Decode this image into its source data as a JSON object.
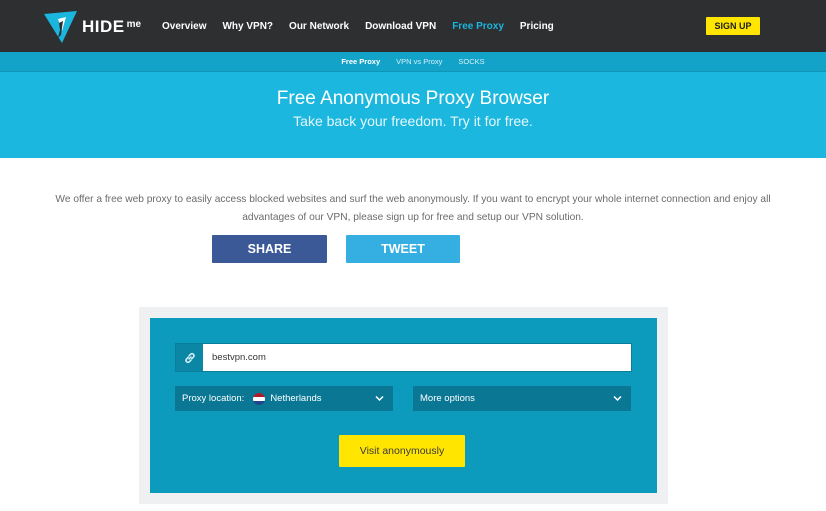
{
  "header": {
    "logo_text": "HIDE",
    "logo_suffix": "me",
    "nav": [
      {
        "label": "Overview",
        "active": false
      },
      {
        "label": "Why VPN?",
        "active": false
      },
      {
        "label": "Our Network",
        "active": false
      },
      {
        "label": "Download VPN",
        "active": false
      },
      {
        "label": "Free Proxy",
        "active": true
      },
      {
        "label": "Pricing",
        "active": false
      }
    ],
    "signup_label": "SIGN UP"
  },
  "subnav": [
    {
      "label": "Free Proxy",
      "active": true
    },
    {
      "label": "VPN vs Proxy",
      "active": false
    },
    {
      "label": "SOCKS",
      "active": false
    }
  ],
  "hero": {
    "title": "Free Anonymous Proxy Browser",
    "subtitle": "Take back your freedom. Try it for free."
  },
  "intro": {
    "line1": "We offer a free web proxy to easily access blocked websites and surf the web anonymously. If you want to encrypt your whole internet connection and enjoy all",
    "line2": "advantages of our VPN, please sign up for free and setup our VPN solution."
  },
  "social": {
    "share_label": "SHARE",
    "tweet_label": "TWEET"
  },
  "proxy_form": {
    "url_value": "bestvpn.com",
    "location_label": "Proxy location:",
    "location_value": "Netherlands",
    "more_options_label": "More options",
    "submit_label": "Visit anonymously"
  },
  "colors": {
    "topbar": "#2d2f31",
    "accent": "#1ab6dd",
    "hero": "#1cb7df",
    "panel": "#0c9bbd",
    "yellow": "#ffe500",
    "facebook": "#3b5997",
    "twitter": "#35aee1"
  },
  "icons": [
    "hideme-logo-icon",
    "link-icon",
    "netherlands-flag-icon",
    "chevron-down-icon"
  ]
}
